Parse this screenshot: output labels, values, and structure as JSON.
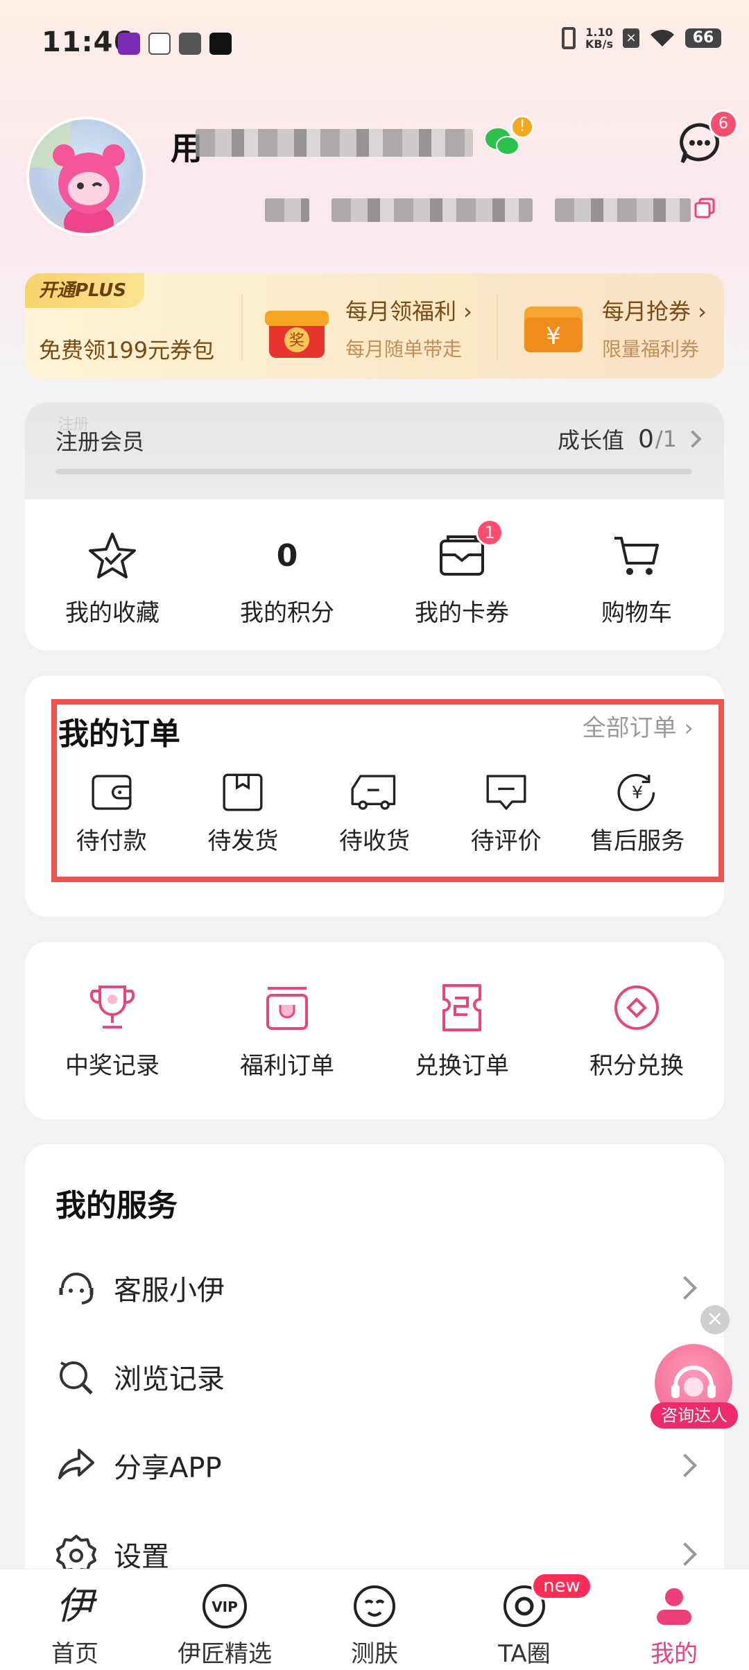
{
  "status_bar": {
    "time": "11:46",
    "net_speed_value": "1.10",
    "net_speed_unit": "KB/s",
    "battery": "66"
  },
  "profile": {
    "name_prefix": "用",
    "message_badge": "6",
    "wechat_alert": "!"
  },
  "promo": {
    "tag": "开通PLUS",
    "plus_text": "免费领199元券包",
    "item1_title": "每月领福利 ›",
    "item1_sub": "每月随单带走",
    "item1_icon_text": "奖",
    "item2_title": "每月抢券 ›",
    "item2_sub": "限量福利券",
    "item2_icon_text": "¥"
  },
  "level": {
    "name": "注册会员",
    "watermark": "注册",
    "growth_label": "成长值",
    "growth_current": "0",
    "growth_total": "/1"
  },
  "quick": {
    "favorites": "我的收藏",
    "points_value": "0",
    "points": "我的积分",
    "coupons": "我的卡券",
    "coupons_badge": "1",
    "cart": "购物车"
  },
  "orders": {
    "title": "我的订单",
    "all_orders": "全部订单 ›",
    "items": [
      "待付款",
      "待发货",
      "待收货",
      "待评价",
      "售后服务"
    ]
  },
  "benefits": {
    "items": [
      "中奖记录",
      "福利订单",
      "兑换订单",
      "积分兑换"
    ]
  },
  "services": {
    "title": "我的服务",
    "items": [
      "客服小伊",
      "浏览记录",
      "分享APP",
      "设置"
    ]
  },
  "floating": {
    "consult_label": "咨询达人",
    "close": "×"
  },
  "tabs": {
    "items": [
      "首页",
      "伊匠精选",
      "测肤",
      "TA圈",
      "我的"
    ],
    "new_badge": "new",
    "home_logo": "伊",
    "vip_text": "VIP"
  },
  "colors": {
    "accent": "#ef3f79",
    "highlight": "#ef5350"
  }
}
